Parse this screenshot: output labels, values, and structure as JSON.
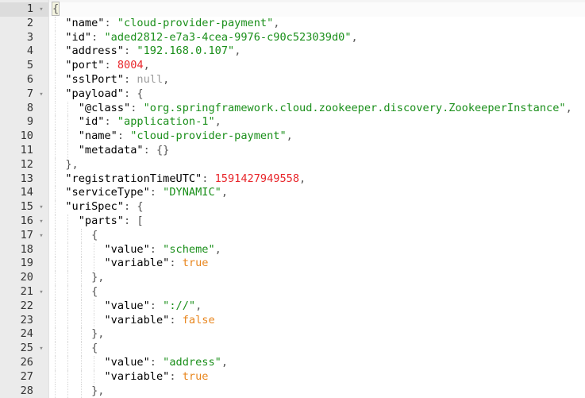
{
  "editor": {
    "fold_marker": "▾",
    "lines": [
      {
        "n": "1",
        "fold": true,
        "active": true,
        "tokens": [
          {
            "t": "p",
            "v": "{"
          }
        ]
      },
      {
        "n": "2",
        "tokens": [
          {
            "t": "ws",
            "v": "  "
          },
          {
            "t": "k",
            "v": "\"name\""
          },
          {
            "t": "p",
            "v": ": "
          },
          {
            "t": "s",
            "v": "\"cloud-provider-payment\""
          },
          {
            "t": "p",
            "v": ","
          }
        ]
      },
      {
        "n": "3",
        "tokens": [
          {
            "t": "ws",
            "v": "  "
          },
          {
            "t": "k",
            "v": "\"id\""
          },
          {
            "t": "p",
            "v": ": "
          },
          {
            "t": "s",
            "v": "\"aded2812-e7a3-4cea-9976-c90c523039d0\""
          },
          {
            "t": "p",
            "v": ","
          }
        ]
      },
      {
        "n": "4",
        "tokens": [
          {
            "t": "ws",
            "v": "  "
          },
          {
            "t": "k",
            "v": "\"address\""
          },
          {
            "t": "p",
            "v": ": "
          },
          {
            "t": "s",
            "v": "\"192.168.0.107\""
          },
          {
            "t": "p",
            "v": ","
          }
        ]
      },
      {
        "n": "5",
        "tokens": [
          {
            "t": "ws",
            "v": "  "
          },
          {
            "t": "k",
            "v": "\"port\""
          },
          {
            "t": "p",
            "v": ": "
          },
          {
            "t": "n",
            "v": "8004"
          },
          {
            "t": "p",
            "v": ","
          }
        ]
      },
      {
        "n": "6",
        "tokens": [
          {
            "t": "ws",
            "v": "  "
          },
          {
            "t": "k",
            "v": "\"sslPort\""
          },
          {
            "t": "p",
            "v": ": "
          },
          {
            "t": "nl",
            "v": "null"
          },
          {
            "t": "p",
            "v": ","
          }
        ]
      },
      {
        "n": "7",
        "fold": true,
        "tokens": [
          {
            "t": "ws",
            "v": "  "
          },
          {
            "t": "k",
            "v": "\"payload\""
          },
          {
            "t": "p",
            "v": ": {"
          }
        ]
      },
      {
        "n": "8",
        "tokens": [
          {
            "t": "ws",
            "v": "    "
          },
          {
            "t": "k",
            "v": "\"@class\""
          },
          {
            "t": "p",
            "v": ": "
          },
          {
            "t": "s",
            "v": "\"org.springframework.cloud.zookeeper.discovery.ZookeeperInstance\""
          },
          {
            "t": "p",
            "v": ","
          }
        ]
      },
      {
        "n": "9",
        "tokens": [
          {
            "t": "ws",
            "v": "    "
          },
          {
            "t": "k",
            "v": "\"id\""
          },
          {
            "t": "p",
            "v": ": "
          },
          {
            "t": "s",
            "v": "\"application-1\""
          },
          {
            "t": "p",
            "v": ","
          }
        ]
      },
      {
        "n": "10",
        "tokens": [
          {
            "t": "ws",
            "v": "    "
          },
          {
            "t": "k",
            "v": "\"name\""
          },
          {
            "t": "p",
            "v": ": "
          },
          {
            "t": "s",
            "v": "\"cloud-provider-payment\""
          },
          {
            "t": "p",
            "v": ","
          }
        ]
      },
      {
        "n": "11",
        "tokens": [
          {
            "t": "ws",
            "v": "    "
          },
          {
            "t": "k",
            "v": "\"metadata\""
          },
          {
            "t": "p",
            "v": ": {}"
          }
        ]
      },
      {
        "n": "12",
        "tokens": [
          {
            "t": "ws",
            "v": "  "
          },
          {
            "t": "p",
            "v": "},"
          }
        ]
      },
      {
        "n": "13",
        "tokens": [
          {
            "t": "ws",
            "v": "  "
          },
          {
            "t": "k",
            "v": "\"registrationTimeUTC\""
          },
          {
            "t": "p",
            "v": ": "
          },
          {
            "t": "n",
            "v": "1591427949558"
          },
          {
            "t": "p",
            "v": ","
          }
        ]
      },
      {
        "n": "14",
        "tokens": [
          {
            "t": "ws",
            "v": "  "
          },
          {
            "t": "k",
            "v": "\"serviceType\""
          },
          {
            "t": "p",
            "v": ": "
          },
          {
            "t": "s",
            "v": "\"DYNAMIC\""
          },
          {
            "t": "p",
            "v": ","
          }
        ]
      },
      {
        "n": "15",
        "fold": true,
        "tokens": [
          {
            "t": "ws",
            "v": "  "
          },
          {
            "t": "k",
            "v": "\"uriSpec\""
          },
          {
            "t": "p",
            "v": ": {"
          }
        ]
      },
      {
        "n": "16",
        "fold": true,
        "tokens": [
          {
            "t": "ws",
            "v": "    "
          },
          {
            "t": "k",
            "v": "\"parts\""
          },
          {
            "t": "p",
            "v": ": ["
          }
        ]
      },
      {
        "n": "17",
        "fold": true,
        "tokens": [
          {
            "t": "ws",
            "v": "      "
          },
          {
            "t": "p",
            "v": "{"
          }
        ]
      },
      {
        "n": "18",
        "tokens": [
          {
            "t": "ws",
            "v": "        "
          },
          {
            "t": "k",
            "v": "\"value\""
          },
          {
            "t": "p",
            "v": ": "
          },
          {
            "t": "s",
            "v": "\"scheme\""
          },
          {
            "t": "p",
            "v": ","
          }
        ]
      },
      {
        "n": "19",
        "tokens": [
          {
            "t": "ws",
            "v": "        "
          },
          {
            "t": "k",
            "v": "\"variable\""
          },
          {
            "t": "p",
            "v": ": "
          },
          {
            "t": "b",
            "v": "true"
          }
        ]
      },
      {
        "n": "20",
        "tokens": [
          {
            "t": "ws",
            "v": "      "
          },
          {
            "t": "p",
            "v": "},"
          }
        ]
      },
      {
        "n": "21",
        "fold": true,
        "tokens": [
          {
            "t": "ws",
            "v": "      "
          },
          {
            "t": "p",
            "v": "{"
          }
        ]
      },
      {
        "n": "22",
        "tokens": [
          {
            "t": "ws",
            "v": "        "
          },
          {
            "t": "k",
            "v": "\"value\""
          },
          {
            "t": "p",
            "v": ": "
          },
          {
            "t": "s",
            "v": "\"://\""
          },
          {
            "t": "p",
            "v": ","
          }
        ]
      },
      {
        "n": "23",
        "tokens": [
          {
            "t": "ws",
            "v": "        "
          },
          {
            "t": "k",
            "v": "\"variable\""
          },
          {
            "t": "p",
            "v": ": "
          },
          {
            "t": "b",
            "v": "false"
          }
        ]
      },
      {
        "n": "24",
        "tokens": [
          {
            "t": "ws",
            "v": "      "
          },
          {
            "t": "p",
            "v": "},"
          }
        ]
      },
      {
        "n": "25",
        "fold": true,
        "tokens": [
          {
            "t": "ws",
            "v": "      "
          },
          {
            "t": "p",
            "v": "{"
          }
        ]
      },
      {
        "n": "26",
        "tokens": [
          {
            "t": "ws",
            "v": "        "
          },
          {
            "t": "k",
            "v": "\"value\""
          },
          {
            "t": "p",
            "v": ": "
          },
          {
            "t": "s",
            "v": "\"address\""
          },
          {
            "t": "p",
            "v": ","
          }
        ]
      },
      {
        "n": "27",
        "tokens": [
          {
            "t": "ws",
            "v": "        "
          },
          {
            "t": "k",
            "v": "\"variable\""
          },
          {
            "t": "p",
            "v": ": "
          },
          {
            "t": "b",
            "v": "true"
          }
        ]
      },
      {
        "n": "28",
        "tokens": [
          {
            "t": "ws",
            "v": "      "
          },
          {
            "t": "p",
            "v": "},"
          }
        ]
      }
    ]
  }
}
